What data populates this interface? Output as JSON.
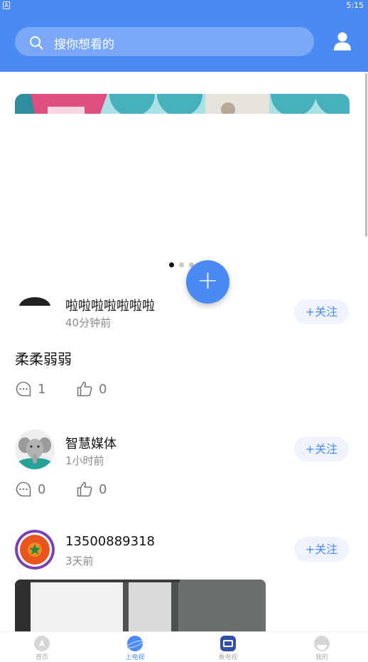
{
  "status_bar": {
    "time": "5:15",
    "left_icon": "A"
  },
  "search": {
    "placeholder": "搜你想看的"
  },
  "banner": {
    "carousel_dots": 3,
    "active_dot": 0
  },
  "fab": {
    "label": "+"
  },
  "posts": [
    {
      "author": "啦啦啦啦啦啦啦",
      "time": "40分钟前",
      "follow_label": "+关注",
      "content": "柔柔弱弱",
      "comments": "1",
      "likes": "0"
    },
    {
      "author": "智慧媒体",
      "time": "1小时前",
      "follow_label": "+关注",
      "content": "",
      "comments": "0",
      "likes": "0"
    },
    {
      "author": "13500889318",
      "time": "3天前",
      "follow_label": "+关注",
      "content": "",
      "comments": "",
      "likes": ""
    }
  ],
  "bottom_nav": [
    {
      "label": "首页",
      "icon": "home-icon",
      "active": false
    },
    {
      "label": "上电视",
      "icon": "planet-icon",
      "active": true
    },
    {
      "label": "看电视",
      "icon": "tv-icon",
      "active": false
    },
    {
      "label": "我的",
      "icon": "profile-icon",
      "active": false
    }
  ],
  "colors": {
    "primary": "#4b89f3",
    "search_bg": "#7ba9f8",
    "follow_bg": "#eef3fd"
  }
}
